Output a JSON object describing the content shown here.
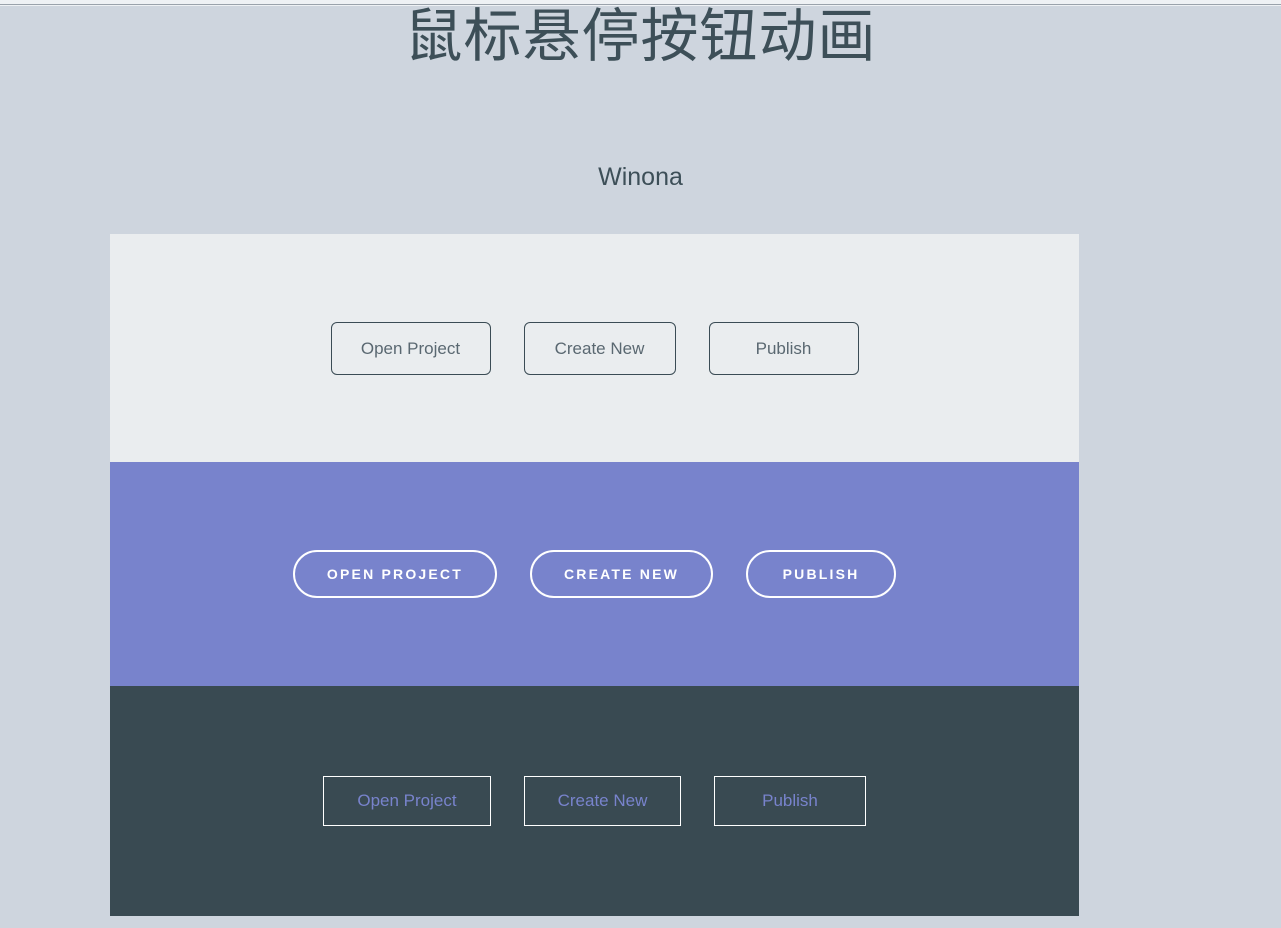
{
  "page": {
    "title": "鼠标悬停按钮动画",
    "subtitle": "Winona",
    "background_color": "#ced5de",
    "title_color": "#3d4f58"
  },
  "demo": {
    "rows": [
      {
        "name": "light-row",
        "style": "outlined-rounded",
        "background_color": "#eaedef",
        "border_color": "#3b4c55",
        "text_color": "#5a6871",
        "text_transform": "none",
        "buttons": [
          {
            "label": "Open Project"
          },
          {
            "label": "Create New"
          },
          {
            "label": "Publish"
          }
        ]
      },
      {
        "name": "purple-row",
        "style": "outlined-pill",
        "background_color": "#7883cc",
        "border_color": "#ffffff",
        "text_color": "#ffffff",
        "text_transform": "uppercase",
        "buttons": [
          {
            "label": "OPEN PROJECT"
          },
          {
            "label": "CREATE NEW"
          },
          {
            "label": "PUBLISH"
          }
        ]
      },
      {
        "name": "dark-row",
        "style": "outlined-square",
        "background_color": "#394a52",
        "border_color": "#ffffff",
        "text_color": "#7883cc",
        "text_transform": "none",
        "buttons": [
          {
            "label": "Open Project"
          },
          {
            "label": "Create New"
          },
          {
            "label": "Publish"
          }
        ]
      }
    ]
  }
}
